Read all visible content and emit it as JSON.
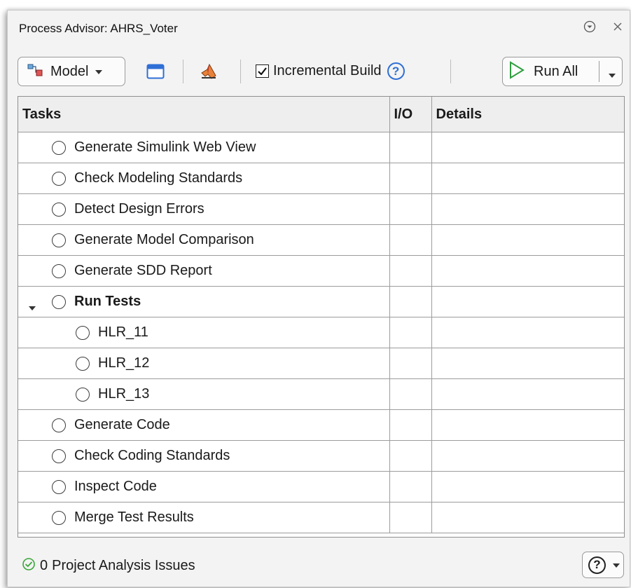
{
  "window": {
    "title": "Process Advisor: AHRS_Voter",
    "menu_icon": "circle-chevron-down-icon",
    "close_icon": "close-icon"
  },
  "toolbar": {
    "model_label": "Model",
    "layout_icon": "window-layout-icon",
    "matlab_icon": "matlab-icon",
    "incremental_build_label": "Incremental Build",
    "incremental_build_checked": true,
    "help_glyph": "?",
    "run_all_label": "Run All"
  },
  "table": {
    "columns": [
      "Tasks",
      "I/O",
      "Details"
    ],
    "rows": [
      {
        "label": "Generate Simulink Web View",
        "level": 0,
        "bold": false
      },
      {
        "label": "Check Modeling Standards",
        "level": 0,
        "bold": false
      },
      {
        "label": "Detect Design Errors",
        "level": 0,
        "bold": false
      },
      {
        "label": "Generate Model Comparison",
        "level": 0,
        "bold": false
      },
      {
        "label": "Generate SDD Report",
        "level": 0,
        "bold": false
      },
      {
        "label": "Run Tests",
        "level": 0,
        "bold": true,
        "expanded": true
      },
      {
        "label": "HLR_11",
        "level": 1,
        "bold": false
      },
      {
        "label": "HLR_12",
        "level": 1,
        "bold": false
      },
      {
        "label": "HLR_13",
        "level": 1,
        "bold": false
      },
      {
        "label": "Generate Code",
        "level": 0,
        "bold": false
      },
      {
        "label": "Check Coding Standards",
        "level": 0,
        "bold": false
      },
      {
        "label": "Inspect Code",
        "level": 0,
        "bold": false
      },
      {
        "label": "Merge Test Results",
        "level": 0,
        "bold": false
      }
    ]
  },
  "status": {
    "count": "0",
    "label": "Project Analysis Issues",
    "ok_color": "#3aa63a"
  },
  "help_button": {
    "glyph": "?"
  },
  "colors": {
    "accent_blue": "#2f6fd6",
    "run_green": "#2e9e3e"
  }
}
